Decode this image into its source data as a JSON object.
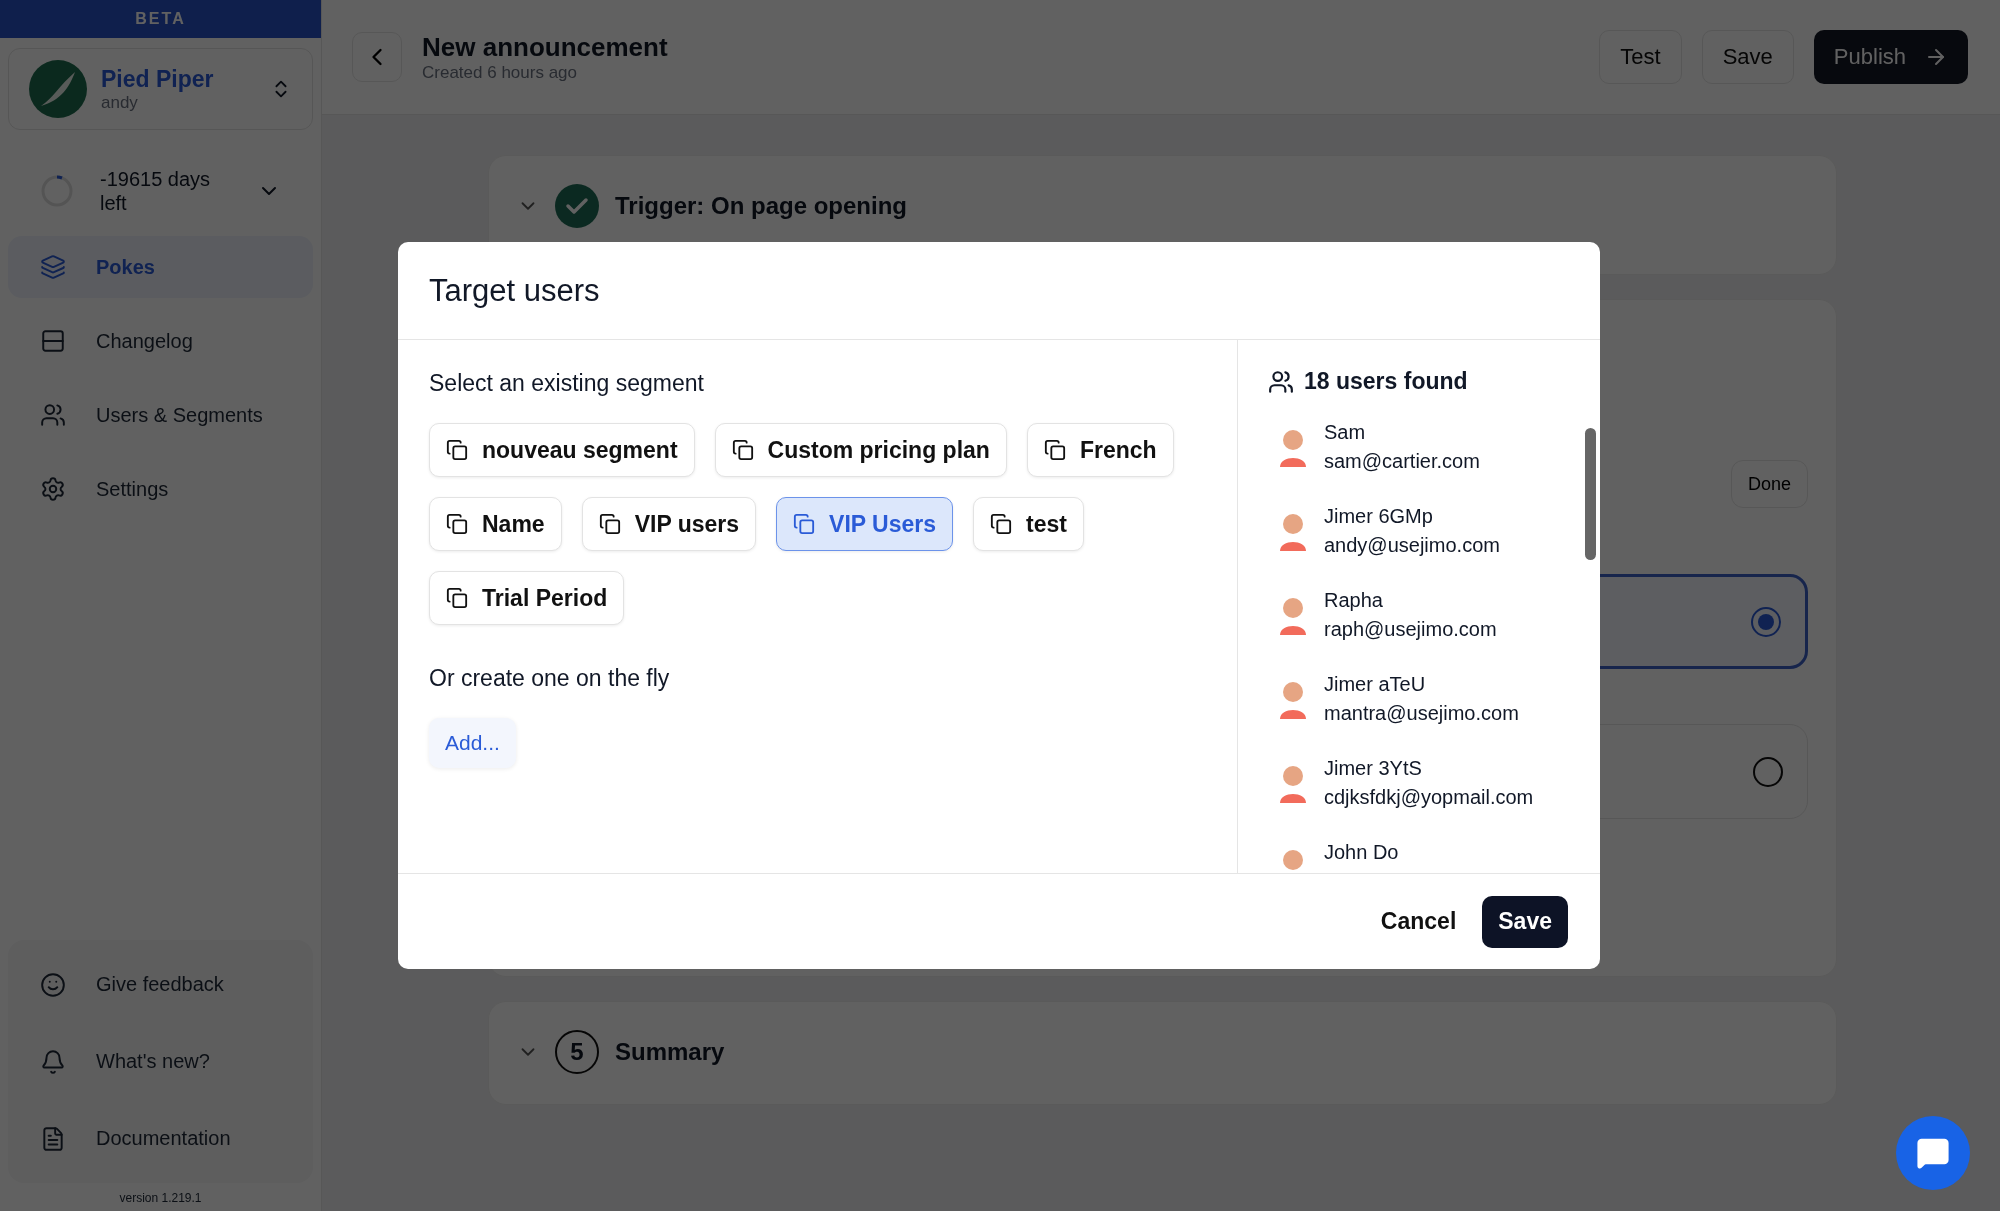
{
  "sidebar": {
    "banner": "BETA",
    "workspace": {
      "name": "Pied Piper",
      "user": "andy"
    },
    "trial": "-19615 days left",
    "nav": [
      {
        "label": "Pokes",
        "selected": true
      },
      {
        "label": "Changelog",
        "selected": false
      },
      {
        "label": "Users & Segments",
        "selected": false
      },
      {
        "label": "Settings",
        "selected": false
      }
    ],
    "footer_links": [
      {
        "label": "Give feedback"
      },
      {
        "label": "What's new?"
      },
      {
        "label": "Documentation"
      }
    ],
    "version": "version 1.219.1"
  },
  "header": {
    "title": "New announcement",
    "subtitle": "Created 6 hours ago",
    "buttons": [
      "Test",
      "Save"
    ],
    "primary": "Publish"
  },
  "steps": [
    {
      "kind": "done",
      "title": "Trigger: On page opening"
    },
    {
      "kind": "options",
      "button": "Done",
      "options": [
        {
          "selected": true
        },
        {
          "selected": false
        }
      ]
    },
    {
      "kind": "number",
      "number": "5",
      "title": "Summary"
    }
  ],
  "modal": {
    "title": "Target users",
    "segment_heading": "Select an existing segment",
    "segments": [
      {
        "label": "nouveau segment",
        "selected": false
      },
      {
        "label": "Custom pricing plan",
        "selected": false
      },
      {
        "label": "French",
        "selected": false
      },
      {
        "label": "Name",
        "selected": false
      },
      {
        "label": "VIP users",
        "selected": false
      },
      {
        "label": "VIP Users",
        "selected": true
      },
      {
        "label": "test",
        "selected": false
      },
      {
        "label": "Trial Period",
        "selected": false
      }
    ],
    "create_heading": "Or create one on the fly",
    "add_button": "Add...",
    "users_found": "18 users found",
    "users": [
      {
        "name": "Sam",
        "email": "sam@cartier.com"
      },
      {
        "name": "Jimer 6GMp",
        "email": "andy@usejimo.com"
      },
      {
        "name": "Rapha",
        "email": "raph@usejimo.com"
      },
      {
        "name": "Jimer aTeU",
        "email": "mantra@usejimo.com"
      },
      {
        "name": "Jimer 3YtS",
        "email": "cdjksfdkj@yopmail.com"
      },
      {
        "name": "John Do"
      }
    ],
    "cancel": "Cancel",
    "save": "Save"
  }
}
